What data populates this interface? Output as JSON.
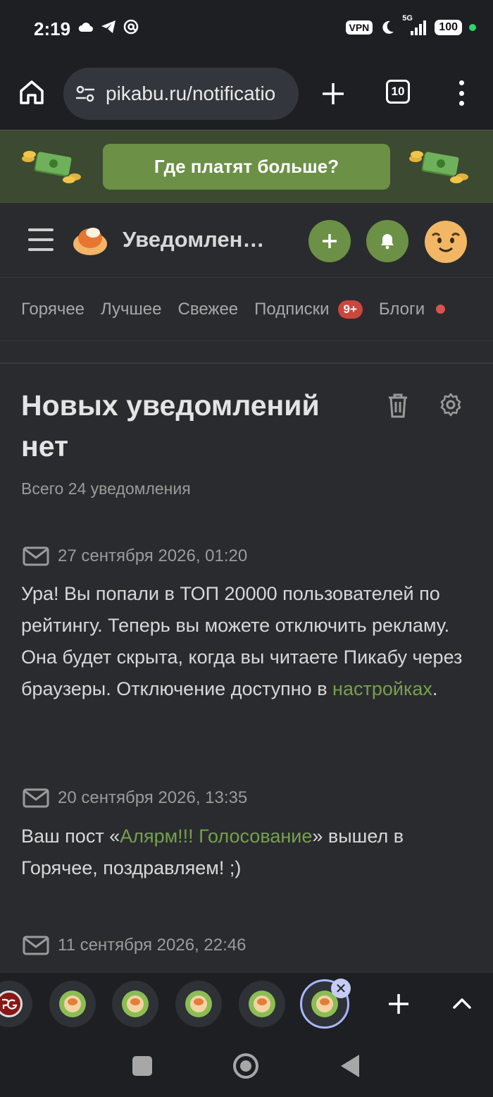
{
  "status_bar": {
    "time": "2:19",
    "left_icons": [
      "cloud-icon",
      "telegram-icon",
      "at-icon"
    ],
    "vpn": "VPN",
    "network": "5G",
    "battery": "100"
  },
  "browser": {
    "url": "pikabu.ru/notificatio",
    "tab_count": "10"
  },
  "banner": {
    "button_label": "Где платят больше?"
  },
  "header": {
    "title": "Уведомлен…"
  },
  "nav": {
    "tabs": [
      {
        "label": "Горячее"
      },
      {
        "label": "Лучшее"
      },
      {
        "label": "Свежее"
      },
      {
        "label": "Подписки",
        "badge": "9+"
      },
      {
        "label": "Блоги"
      }
    ]
  },
  "main": {
    "heading": "Новых уведомлений нет",
    "total": "Всего 24 уведомления",
    "notifications": [
      {
        "date": "27 сентября 2026, 01:20",
        "text_before": "Ура! Вы попали в ТОП 20000 пользователей по рейтингу. Теперь вы можете отключить рекламу. Она будет скрыта, когда вы читаете Пикабу через браузеры. Отключение доступно в ",
        "link": "настройках",
        "text_after": "."
      },
      {
        "date": "20 сентября 2026, 13:35",
        "text_before": "Ваш пост «",
        "link": "Алярм!!! Голосование",
        "text_after": "» вышел в Горячее, поздравляем! ;)"
      },
      {
        "date": "11 сентября 2026, 22:46"
      }
    ]
  },
  "colors": {
    "accent_green": "#6b9046",
    "link_green": "#76a04f",
    "badge_red": "#c9473e",
    "background": "#2a2b2e"
  }
}
